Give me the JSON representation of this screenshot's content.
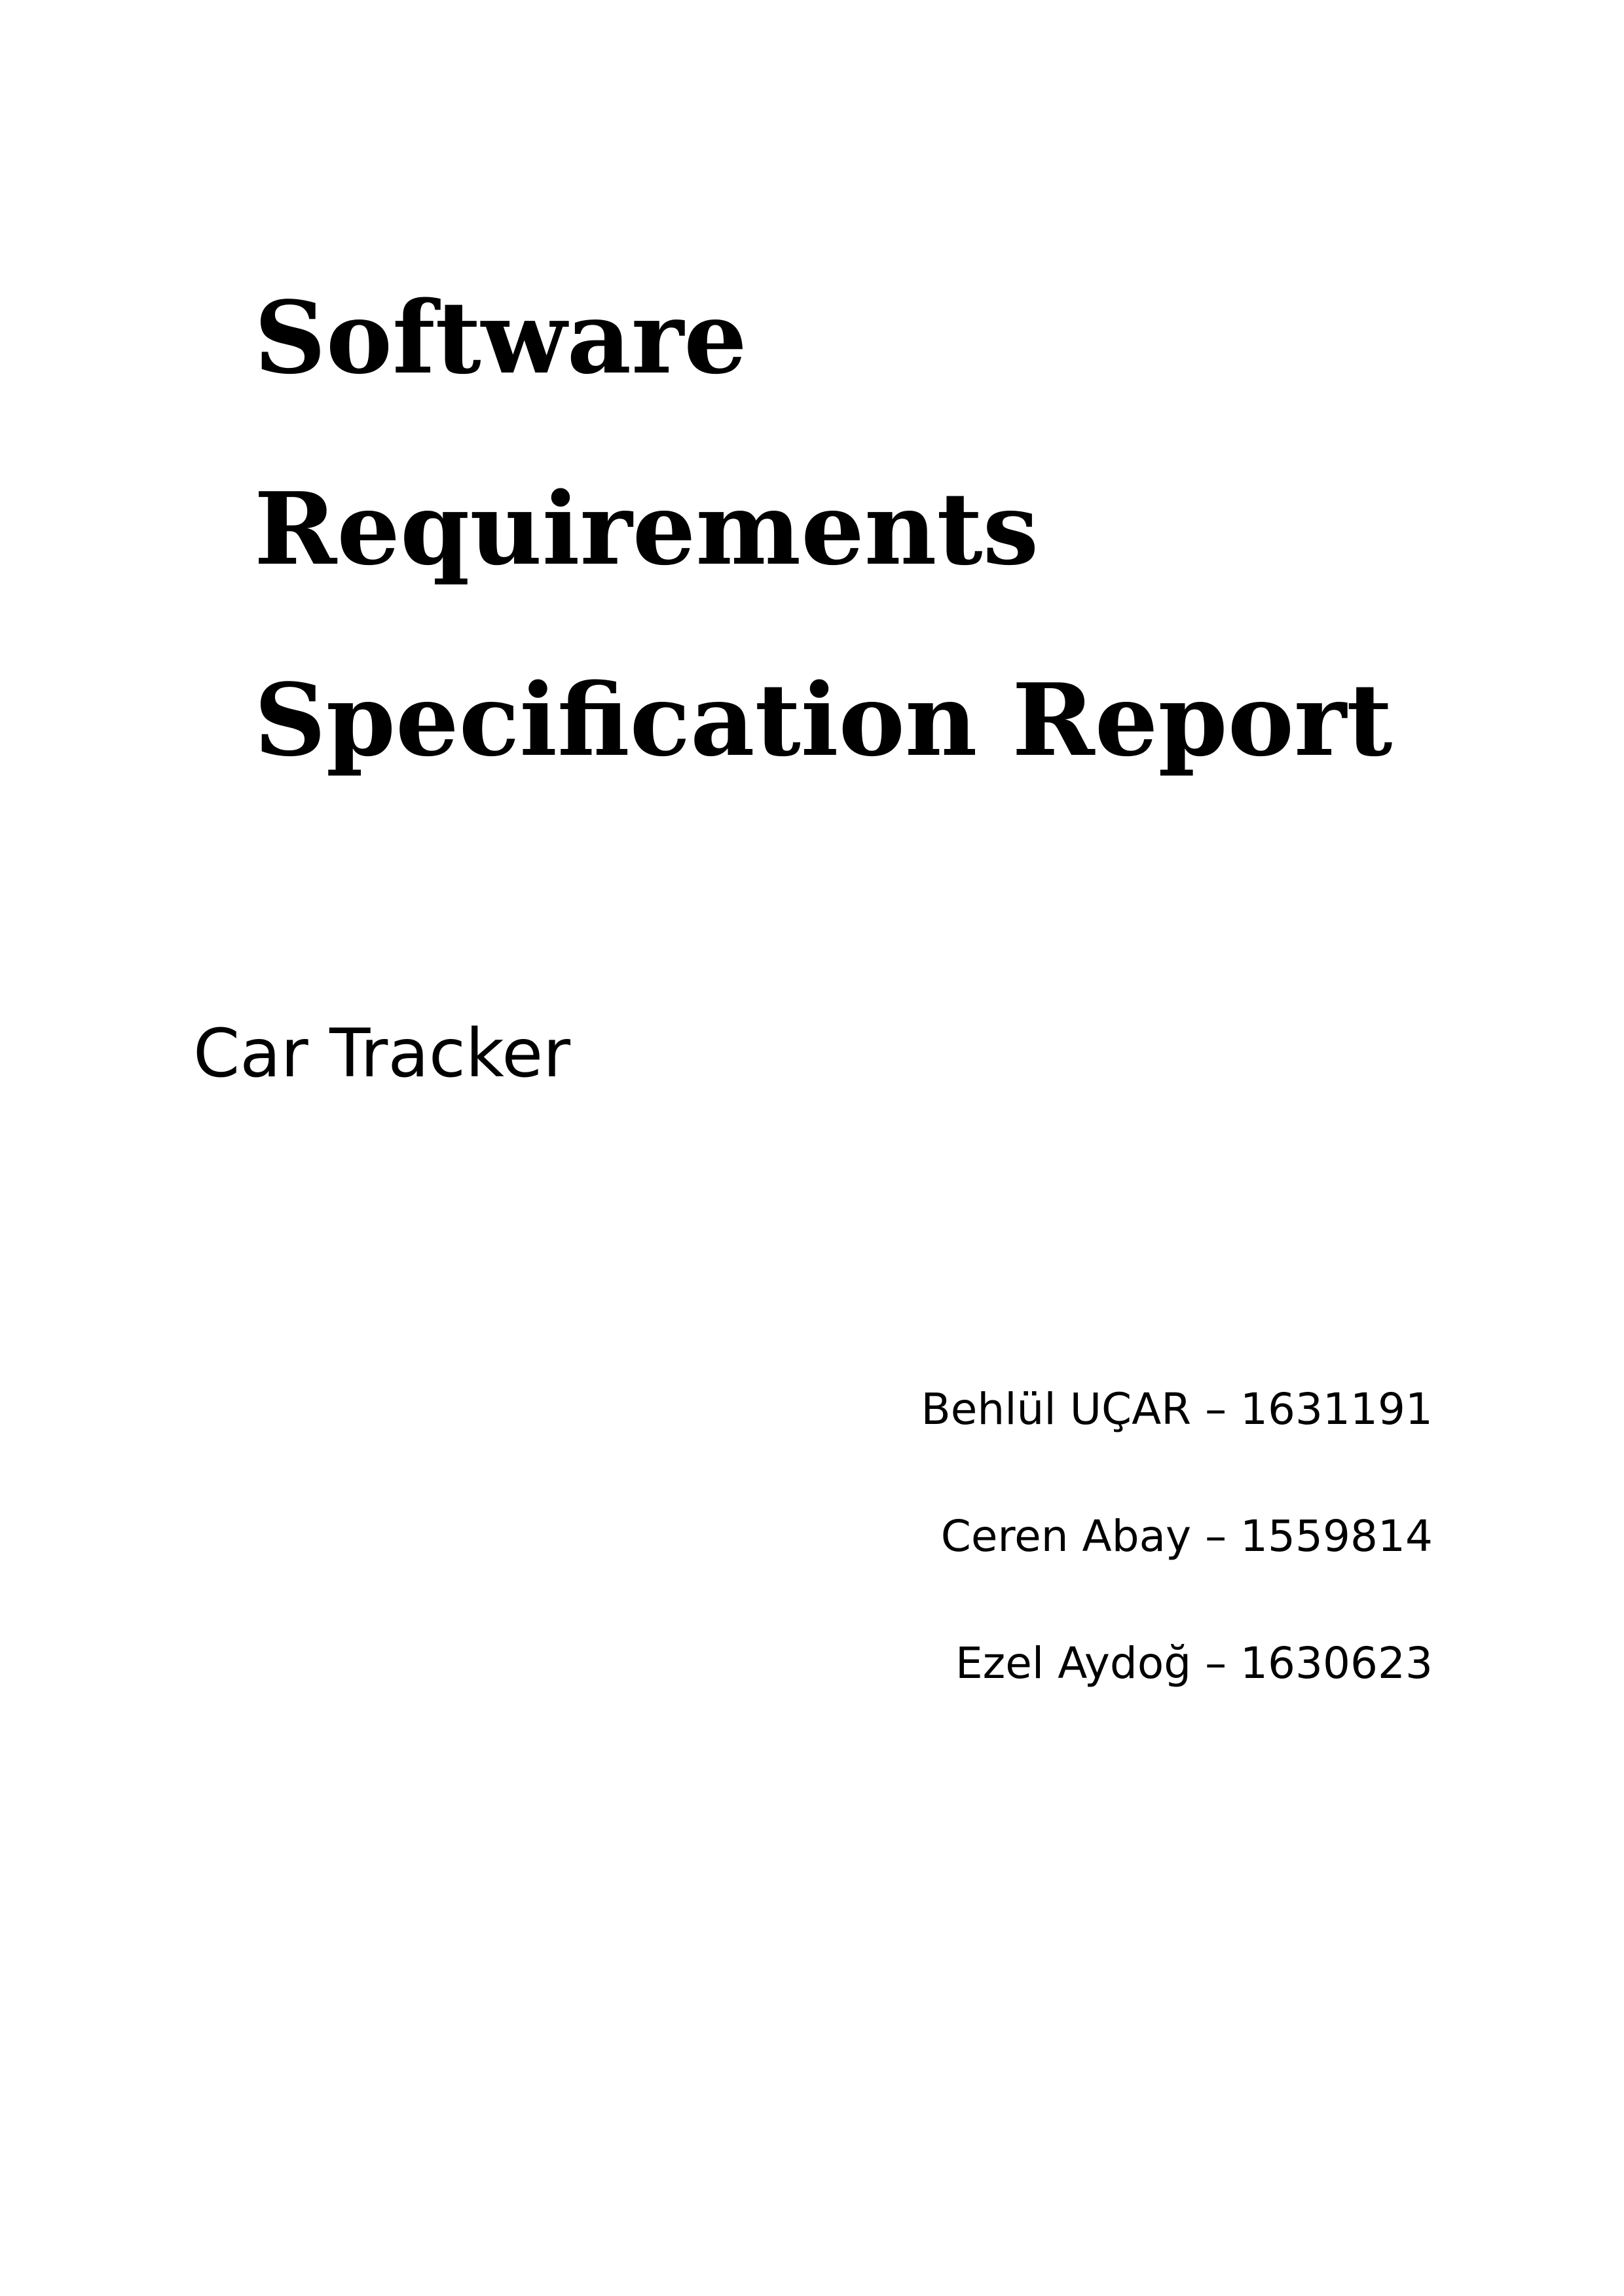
{
  "document": {
    "title_lines": [
      "Software",
      "Requirements",
      "Specification Report"
    ],
    "subtitle": "Car Tracker",
    "authors": [
      "Behlül UÇAR – 1631191",
      "Ceren Abay – 1559814",
      "Ezel Aydoğ – 1630623"
    ]
  }
}
